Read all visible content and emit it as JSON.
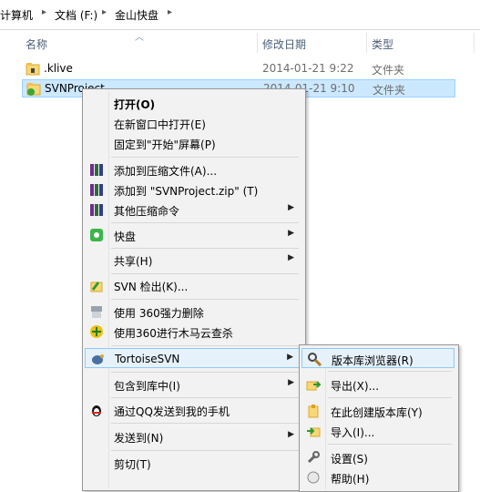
{
  "breadcrumb": {
    "items": [
      "计算机",
      "文档 (F:)",
      "金山快盘"
    ]
  },
  "columns": {
    "name": "名称",
    "date": "修改日期",
    "type": "类型"
  },
  "files": [
    {
      "name": ".klive",
      "date": "2014-01-21 9:22",
      "type": "文件夹"
    },
    {
      "name": "SVNProject",
      "date": "2014-01-21 9:10",
      "type": "文件夹"
    }
  ],
  "context_menu": {
    "items": {
      "open": "打开(O)",
      "open_new_window": "在新窗口中打开(E)",
      "pin_start": "固定到\"开始\"屏幕(P)",
      "add_archive": "添加到压缩文件(A)...",
      "add_zip": "添加到 \"SVNProject.zip\" (T)",
      "other_compress": "其他压缩命令",
      "kuaipan": "快盘",
      "share": "共享(H)",
      "svn_checkout": "SVN 检出(K)...",
      "delete_360": "使用 360强力删除",
      "scan_360": "使用360进行木马云查杀",
      "tortoise": "TortoiseSVN",
      "include_library": "包含到库中(I)",
      "send_qq": "通过QQ发送到我的手机",
      "send_to": "发送到(N)",
      "cut": "剪切(T)"
    }
  },
  "submenu": {
    "items": {
      "repo_browser": "版本库浏览器(R)",
      "export": "导出(X)...",
      "create_repo": "在此创建版本库(Y)",
      "import": "导入(I)...",
      "settings": "设置(S)",
      "help": "帮助(H)"
    }
  },
  "colors": {
    "selection": "#cce8ff",
    "highlight": "#e5f1fb",
    "header_text": "#4c607a"
  }
}
